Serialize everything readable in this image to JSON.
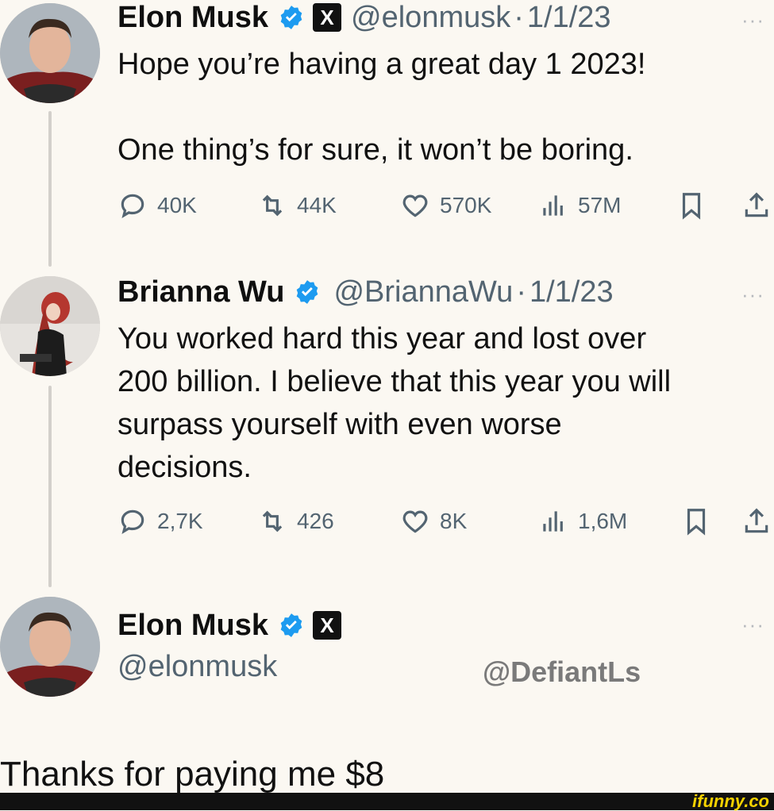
{
  "tweet1": {
    "name": "Elon Musk",
    "x_badge": "X",
    "handle": "@elonmusk",
    "date": "1/1/23",
    "more": "···",
    "text_lines": [
      "Hope you’re having a great day 1 2023!",
      "",
      "One thing’s for sure, it won’t be boring."
    ],
    "replies": "40K",
    "reposts": "44K",
    "likes": "570K",
    "views": "57M"
  },
  "tweet2": {
    "name": "Brianna Wu",
    "handle": "@BriannaWu",
    "date": "1/1/23",
    "more": "···",
    "text_lines": [
      "You worked hard this year and lost over",
      "200 billion. I believe that this year you will",
      "surpass yourself with even worse",
      "decisions."
    ],
    "replies": "2,7K",
    "reposts": "426",
    "likes": "8K",
    "views": "1,6M"
  },
  "tweet3": {
    "name": "Elon Musk",
    "x_badge": "X",
    "handle": "@elonmusk",
    "more": "···"
  },
  "watermark": "@DefiantLs",
  "caption": "Thanks for paying me $8",
  "ifunny": "ifunny.co",
  "colors": {
    "background": "#fbf8f2",
    "verified": "#1d9bf0",
    "secondary_text": "#536471",
    "ifunny_yellow": "#f6d200"
  },
  "icons": [
    "reply-icon",
    "repost-icon",
    "like-icon",
    "views-icon",
    "bookmark-icon",
    "share-icon",
    "verified-icon",
    "x-badge-icon"
  ]
}
